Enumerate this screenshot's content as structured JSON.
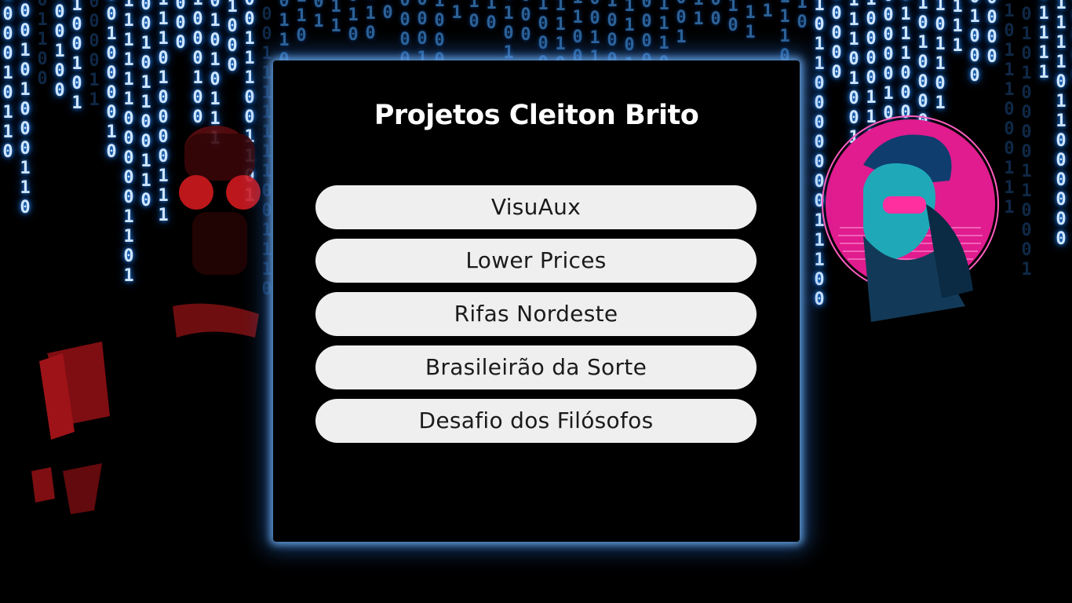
{
  "page": {
    "title": "Projetos Cleiton Brito"
  },
  "projects": [
    {
      "label": "VisuAux"
    },
    {
      "label": "Lower Prices"
    },
    {
      "label": "Rifas Nordeste"
    },
    {
      "label": "Brasileirão da Sorte"
    },
    {
      "label": "Desafio dos Filósofos"
    }
  ],
  "theme": {
    "background": "#000000",
    "panel_glow": "#6aaaeb",
    "button_bg": "#efefef",
    "button_text": "#1b1b1b",
    "rain_color": "#2a8cff",
    "neon_pink": "#ff2fa0",
    "neon_teal": "#1fd6c6"
  },
  "decor": {
    "background": "matrix-binary-rain",
    "left_character": "red-helmet-figure",
    "right_character": "neon-helmet-portrait"
  }
}
